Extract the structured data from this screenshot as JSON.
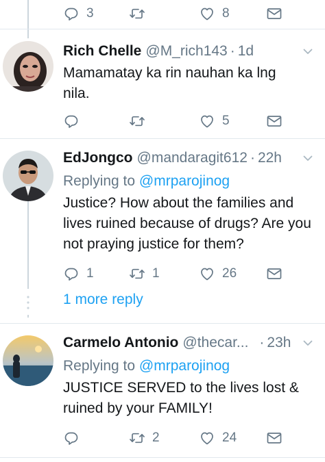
{
  "top_actions": {
    "reply_count": "3",
    "retweet_count": "",
    "like_count": "8"
  },
  "tweets": [
    {
      "name": "Rich Chelle",
      "handle": "@M_rich143",
      "time": "1d",
      "text": "Mamamatay ka rin nauhan ka lng nila.",
      "reply_count": "",
      "retweet_count": "",
      "like_count": "5"
    },
    {
      "name": "EdJongco",
      "handle": "@mandaragit612",
      "time": "22h",
      "replying_prefix": "Replying to",
      "replying_to": "@mrparojinog",
      "text": "Justice? How about the families and lives ruined because of drugs? Are you not praying justice for them?",
      "reply_count": "1",
      "retweet_count": "1",
      "like_count": "26"
    },
    {
      "name": "Carmelo Antonio",
      "handle": "@thecar...",
      "time": "23h",
      "replying_prefix": "Replying to",
      "replying_to": "@mrparojinog",
      "text": "JUSTICE SERVED to the lives lost & ruined by your FAMILY!",
      "reply_count": "",
      "retweet_count": "2",
      "like_count": "24"
    }
  ],
  "more_reply": "1 more reply",
  "icons": {
    "reply": "reply-icon",
    "retweet": "retweet-icon",
    "like": "heart-icon",
    "dm": "envelope-icon",
    "caret": "chevron-down-icon"
  },
  "colors": {
    "link": "#1da1f2",
    "muted": "#657786",
    "line": "#ccd6dd"
  }
}
